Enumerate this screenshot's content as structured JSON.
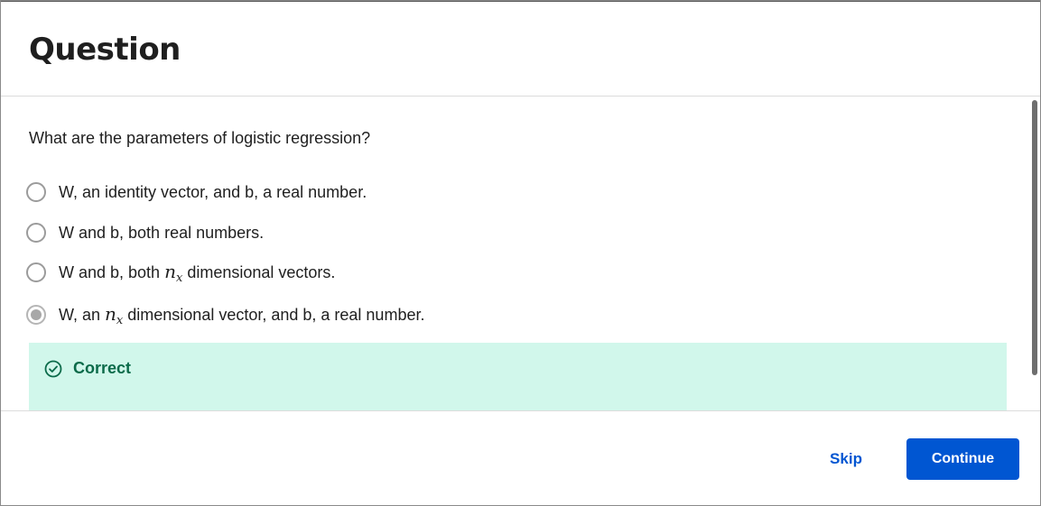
{
  "header": {
    "title": "Question"
  },
  "question": {
    "text": "What are the parameters of logistic regression?"
  },
  "options": [
    {
      "pre": "W, an identity vector, and b, a real number.",
      "math": "",
      "post": "",
      "selected": false
    },
    {
      "pre": "W and b, both real numbers.",
      "math": "",
      "post": "",
      "selected": false
    },
    {
      "pre": "W and b, both ",
      "math_base": "n",
      "math_sub": "x",
      "post": " dimensional vectors.",
      "selected": false
    },
    {
      "pre": "W, an ",
      "math_base": "n",
      "math_sub": "x",
      "post": " dimensional vector, and b, a real number.",
      "selected": true
    }
  ],
  "feedback": {
    "status": "Correct",
    "icon": "check-circle-icon",
    "color": "#0b6b4a",
    "background": "#d1f7eb"
  },
  "footer": {
    "skip_label": "Skip",
    "continue_label": "Continue"
  },
  "colors": {
    "accent": "#0056d2"
  }
}
